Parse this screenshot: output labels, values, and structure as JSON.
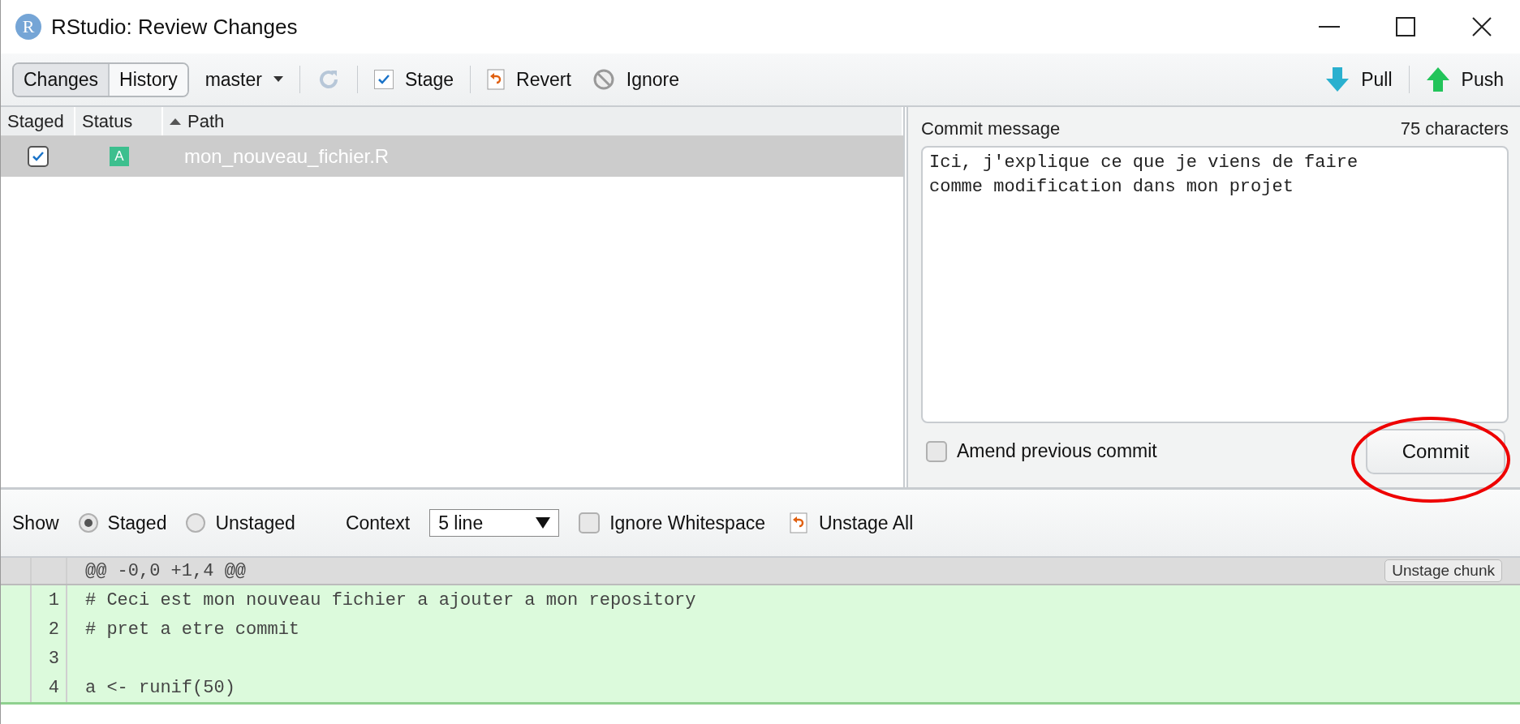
{
  "window": {
    "logo": "R",
    "title": "RStudio: Review Changes"
  },
  "toolbar": {
    "view_tabs": [
      {
        "label": "Changes",
        "selected": true
      },
      {
        "label": "History",
        "selected": false
      }
    ],
    "branch": "master",
    "actions": [
      {
        "kind": "refresh"
      },
      {
        "kind": "stage",
        "label": "Stage"
      },
      {
        "kind": "revert",
        "label": "Revert"
      },
      {
        "kind": "ignore",
        "label": "Ignore"
      }
    ],
    "remote": [
      {
        "kind": "pull",
        "label": "Pull"
      },
      {
        "kind": "push",
        "label": "Push"
      }
    ]
  },
  "files": {
    "columns": [
      "Staged",
      "Status",
      "Path"
    ],
    "rows": [
      {
        "staged": true,
        "status": "A",
        "path": "mon_nouveau_fichier.R",
        "selected": true
      }
    ]
  },
  "commit": {
    "label": "Commit message",
    "count": "75 characters",
    "message": "Ici, j'explique ce que je viens de faire\ncomme modification dans mon projet",
    "amend": {
      "label": "Amend previous commit",
      "checked": false
    },
    "button": "Commit"
  },
  "diff_toolbar": {
    "show_label": "Show",
    "show_options": [
      {
        "label": "Staged",
        "selected": true
      },
      {
        "label": "Unstaged",
        "selected": false
      }
    ],
    "context_label": "Context",
    "context_value": "5 line",
    "ignore_whitespace": {
      "label": "Ignore Whitespace",
      "checked": false
    },
    "unstage_all": "Unstage All"
  },
  "diff": {
    "hunk": "@@ -0,0 +1,4 @@",
    "chunk_button": "Unstage chunk",
    "lines": [
      {
        "number": "1",
        "text": "# Ceci est mon nouveau fichier a ajouter a mon repository"
      },
      {
        "number": "2",
        "text": "# pret a etre commit"
      },
      {
        "number": "3"
      },
      {
        "number": "4",
        "text": "a <- runif(50)"
      }
    ]
  }
}
